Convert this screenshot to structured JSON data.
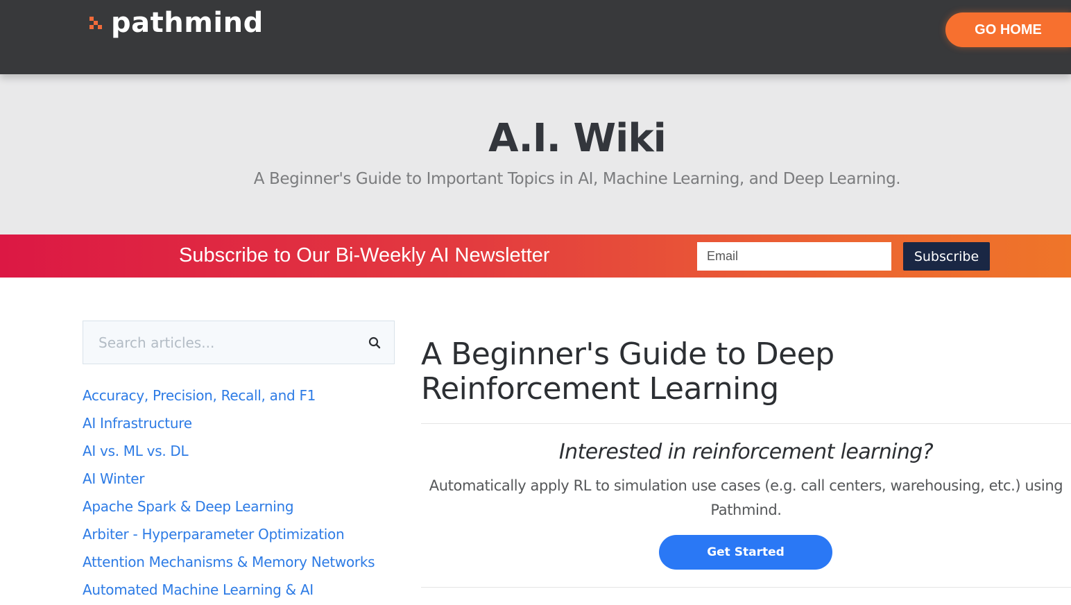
{
  "header": {
    "logo_text": "pathmind",
    "go_home_label": "GO HOME",
    "accent_color": "#f7702f",
    "icons": [
      "pathmind-logo-icon"
    ]
  },
  "hero": {
    "title": "A.I. Wiki",
    "subtitle": "A Beginner's Guide to Important Topics in AI, Machine Learning, and Deep Learning."
  },
  "newsletter": {
    "text": "Subscribe to Our Bi-Weekly AI Newsletter",
    "email_placeholder": "Email",
    "subscribe_label": "Subscribe"
  },
  "sidebar": {
    "search_placeholder": "Search articles...",
    "search_icon": "search-icon",
    "articles": [
      {
        "label": "Accuracy, Precision, Recall, and F1"
      },
      {
        "label": "AI Infrastructure"
      },
      {
        "label": "AI vs. ML vs. DL"
      },
      {
        "label": "AI Winter"
      },
      {
        "label": "Apache Spark & Deep Learning"
      },
      {
        "label": "Arbiter - Hyperparameter Optimization"
      },
      {
        "label": "Attention Mechanisms & Memory Networks"
      },
      {
        "label": "Automated Machine Learning & AI"
      }
    ],
    "link_color": "#2d7be5"
  },
  "main": {
    "title": "A Beginner's Guide to Deep Reinforcement Learning",
    "promo_question": "Interested in reinforcement learning?",
    "promo_description": "Automatically apply RL to simulation use cases (e.g. call centers, warehousing, etc.) using Pathmind.",
    "cta_label": "Get Started",
    "cta_color": "#2a78f5"
  }
}
